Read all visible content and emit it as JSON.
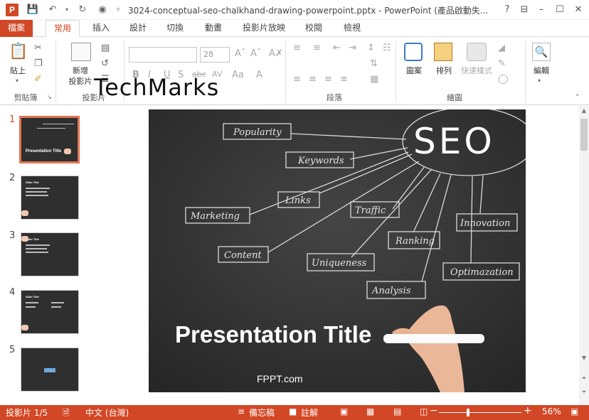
{
  "window": {
    "app_icon_letter": "P",
    "title": "3024-conceptual-seo-chalkhand-drawing-powerpoint.pptx - PowerPoint (產品啟動失..."
  },
  "tabs": [
    "檔案",
    "常用",
    "插入",
    "設計",
    "切換",
    "動畫",
    "投影片放映",
    "校閱",
    "檢視"
  ],
  "ribbon": {
    "paste": "貼上",
    "new_slide_line1": "新增",
    "new_slide_line2": "投影片",
    "font_size": "28",
    "shapes": "圖案",
    "arrange": "排列",
    "quick_styles": "快速樣式",
    "editing": "編輯",
    "groups": {
      "clipboard": "剪貼簿",
      "slides": "投影片",
      "paragraph": "段落",
      "drawing": "繪圖"
    }
  },
  "watermark": "TechMarks",
  "thumbnails": [
    {
      "num": "1",
      "title": "Presentation Title"
    },
    {
      "num": "2",
      "title": "Slide Title"
    },
    {
      "num": "3",
      "title": "Slide Title"
    },
    {
      "num": "4",
      "title": "Slide Title"
    },
    {
      "num": "5",
      "title": ""
    }
  ],
  "slide": {
    "seo": "SEO",
    "words": [
      "Popularity",
      "Keywords",
      "Links",
      "Marketing",
      "Traffic",
      "Content",
      "Uniqueness",
      "Ranking",
      "Innovation",
      "Analysis",
      "Optimazation"
    ],
    "title": "Presentation Title",
    "footer": "FPPT.com"
  },
  "status": {
    "slide_count": "投影片 1/5",
    "language": "中文 (台灣)",
    "notes": "備忘稿",
    "comments": "註解",
    "zoom": "56%"
  }
}
